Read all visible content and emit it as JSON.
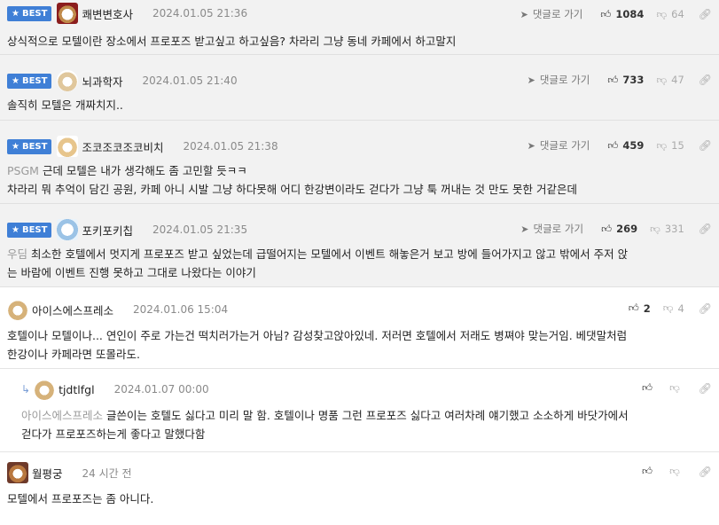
{
  "ui": {
    "best_label": "BEST",
    "goto_label": "댓글로 가기"
  },
  "comments": [
    {
      "nick": "쾌변변호사",
      "date": "2024.01.05 21:36",
      "up": "1084",
      "down": "64",
      "body_lines": [
        "상식적으로 모텔이란 장소에서 프로포즈 받고싶고 하고싶음? 차라리 그냥 동네 카페에서 하고말지"
      ]
    },
    {
      "nick": "뇌과학자",
      "date": "2024.01.05 21:40",
      "up": "733",
      "down": "47",
      "body_lines": [
        "솔직히 모텔은 개짜치지.."
      ]
    },
    {
      "nick": "조코조코조코비치",
      "date": "2024.01.05 21:38",
      "up": "459",
      "down": "15",
      "quote": "PSGM",
      "body_lines": [
        "근데 모텔은 내가 생각해도 좀 고민할 듯ㅋㅋ",
        "차라리 뭐 추억이 담긴 공원, 카페 아니 시발 그냥 하다못해 어디 한강변이라도 걷다가 그냥 툭 꺼내는 것 만도 못한 거같은데"
      ]
    },
    {
      "nick": "포키포키칩",
      "date": "2024.01.05 21:35",
      "up": "269",
      "down": "331",
      "quote": "우딤",
      "body_lines": [
        "최소한 호텔에서 멋지게 프로포즈 받고 싶었는데 급떨어지는 모텔에서 이벤트 해놓은거 보고 방에 들어가지고 않고 밖에서 주저 앉",
        "는 바람에 이벤트 진행 못하고 그대로 나왔다는 이야기"
      ]
    },
    {
      "nick": "아이스에스프레소",
      "date": "2024.01.06 15:04",
      "up": "2",
      "down": "4",
      "body_lines": [
        "호텔이나 모텔이나... 연인이 주로 가는건 떡치러가는거 아님? 감성찾고앉아있네. 저러면 호텔에서 저래도 병쪄야 맞는거임. 베댓말처럼",
        "한강이나 카페라면 또몰라도."
      ]
    },
    {
      "nick": "tjdtlfgl",
      "date": "2024.01.07 00:00",
      "up": "",
      "down": "",
      "quote": "아이스에스프레소",
      "body_lines": [
        "글쓴이는 호텔도 싫다고 미리 말 함. 호텔이나 명품 그런 프로포즈 싫다고 여러차례 얘기했고 소소하게 바닷가에서",
        "걷다가 프로포즈하는게 좋다고 말했다함"
      ]
    },
    {
      "nick": "월평궁",
      "date": "24 시간 전",
      "up": "",
      "down": "",
      "body_lines": [
        "모텔에서 프로포즈는 좀 아니다."
      ]
    }
  ],
  "icons": [
    "star-icon",
    "reply-arrow-icon",
    "thumbs-up-icon",
    "thumbs-down-icon",
    "link-icon",
    "goto-arrow-icon"
  ]
}
